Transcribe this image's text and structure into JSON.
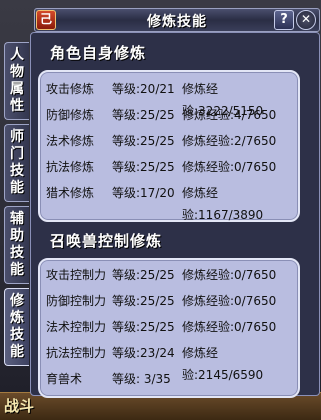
{
  "window": {
    "title": "修炼技能",
    "menu_icon_label": "己",
    "help_label": "?",
    "close_label": "✕"
  },
  "tabs": [
    {
      "label": "人物属性",
      "active": false
    },
    {
      "label": "师门技能",
      "active": false
    },
    {
      "label": "辅助技能",
      "active": false
    },
    {
      "label": "修炼技能",
      "active": true
    }
  ],
  "character": {
    "title": "角色自身修炼",
    "rows": [
      {
        "name": "攻击修炼",
        "level": "等级:20/21",
        "exp": "修炼经验:3222/5150"
      },
      {
        "name": "防御修炼",
        "level": "等级:25/25",
        "exp": "修炼经验:4/7650"
      },
      {
        "name": "法术修炼",
        "level": "等级:25/25",
        "exp": "修炼经验:2/7650"
      },
      {
        "name": "抗法修炼",
        "level": "等级:25/25",
        "exp": "修炼经验:0/7650"
      },
      {
        "name": "猎术修炼",
        "level": "等级:17/20",
        "exp": "修炼经验:1167/3890"
      }
    ]
  },
  "pet": {
    "title": "召唤兽控制修炼",
    "rows": [
      {
        "name": "攻击控制力",
        "level": "等级:25/25",
        "exp": "修炼经验:0/7650"
      },
      {
        "name": "防御控制力",
        "level": "等级:25/25",
        "exp": "修炼经验:0/7650"
      },
      {
        "name": "法术控制力",
        "level": "等级:25/25",
        "exp": "修炼经验:0/7650"
      },
      {
        "name": "抗法控制力",
        "level": "等级:23/24",
        "exp": "修炼经验:2145/6590"
      },
      {
        "name": "育兽术",
        "level": "等级: 3/35",
        "exp": ""
      }
    ]
  },
  "hud": {
    "battle_label": "战斗"
  }
}
